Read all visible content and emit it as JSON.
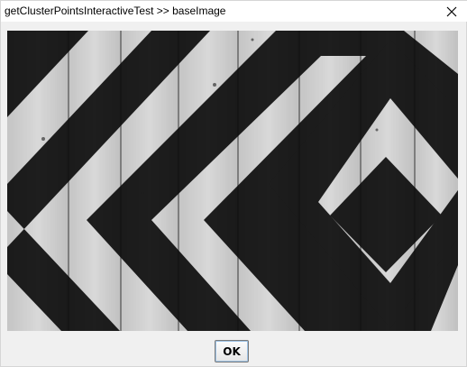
{
  "window": {
    "title": "getClusterPointsInteractiveTest >> baseImage"
  },
  "image": {
    "subject": "black-and-white painted wooden planks with nested diamond chevron stripes",
    "colors": {
      "dark": "#1e1e1e",
      "light": "#d8d8d8"
    }
  },
  "dialog": {
    "ok_label": "OK"
  },
  "icons": {
    "close": "close-icon"
  }
}
